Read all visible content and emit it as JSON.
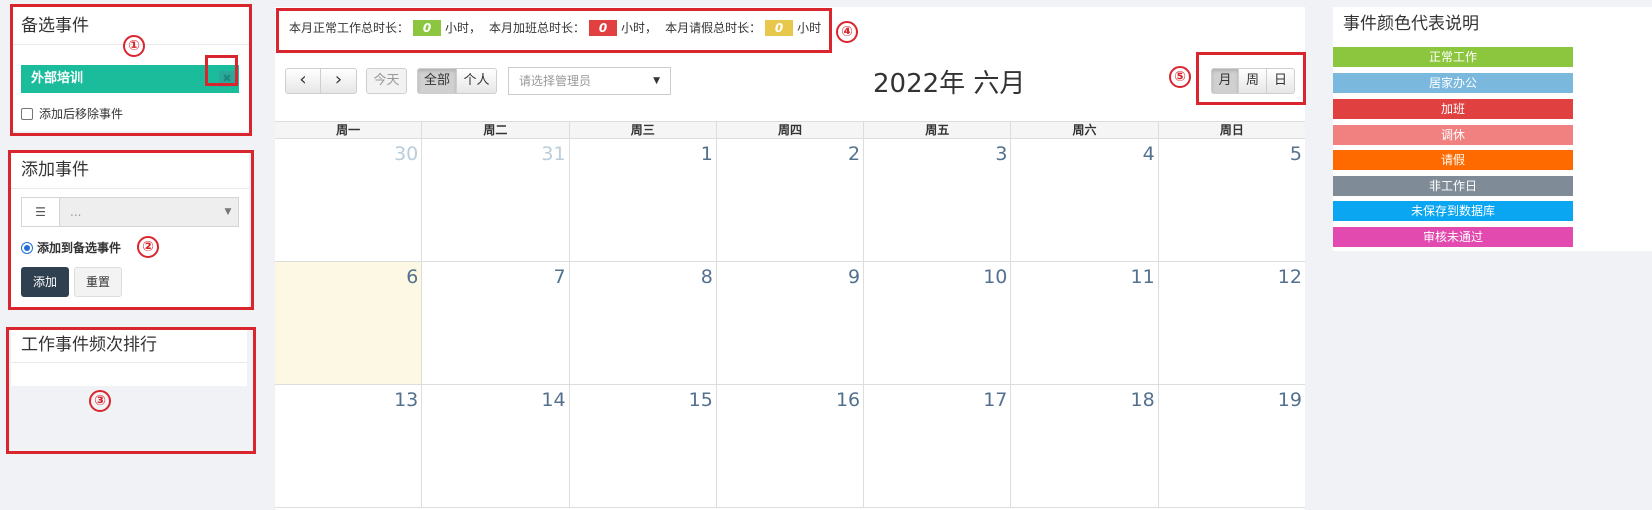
{
  "left_panels": {
    "pending": {
      "title": "备选事件",
      "event_label": "外部培训",
      "remove_label": "添加后移除事件"
    },
    "add": {
      "title": "添加事件",
      "select_placeholder": "...",
      "radio_label": "添加到备选事件",
      "add_button": "添加",
      "reset_button": "重置"
    },
    "ranking": {
      "title": "工作事件频次排行"
    }
  },
  "stats": {
    "normal_label": "本月正常工作总时长：",
    "normal_value": "0",
    "overtime_label": "本月加班总时长：",
    "overtime_value": "0",
    "leave_label": "本月请假总时长：",
    "leave_value": "0",
    "unit_1": "小时，",
    "unit_2": "小时，",
    "unit_3": "小时",
    "colors": {
      "normal": "#8cc63f",
      "overtime": "#e04040",
      "leave": "#e8c84a"
    }
  },
  "toolbar": {
    "prev_icon": "‹",
    "next_icon": "›",
    "today": "今天",
    "all": "全部",
    "personal": "个人",
    "manager_placeholder": "请选择管理员",
    "title": "2022年 六月",
    "views": {
      "month": "月",
      "week": "周",
      "day": "日"
    }
  },
  "calendar": {
    "weekdays": [
      "周一",
      "周二",
      "周三",
      "周四",
      "周五",
      "周六",
      "周日"
    ],
    "weeks": [
      [
        "30",
        "31",
        "1",
        "2",
        "3",
        "4",
        "5"
      ],
      [
        "6",
        "7",
        "8",
        "9",
        "10",
        "11",
        "12"
      ],
      [
        "13",
        "14",
        "15",
        "16",
        "17",
        "18",
        "19"
      ]
    ]
  },
  "legend": {
    "title": "事件颜色代表说明",
    "items": [
      {
        "label": "正常工作",
        "color": "#8cc63f"
      },
      {
        "label": "居家办公",
        "color": "#7ab8de"
      },
      {
        "label": "加班",
        "color": "#e04040"
      },
      {
        "label": "调休",
        "color": "#f18080"
      },
      {
        "label": "请假",
        "color": "#ff6a00"
      },
      {
        "label": "非工作日",
        "color": "#7f8c98"
      },
      {
        "label": "未保存到数据库",
        "color": "#0aa6f2"
      },
      {
        "label": "审核未通过",
        "color": "#e24aaf"
      }
    ]
  },
  "markers": [
    "①",
    "②",
    "③",
    "④",
    "⑤"
  ]
}
